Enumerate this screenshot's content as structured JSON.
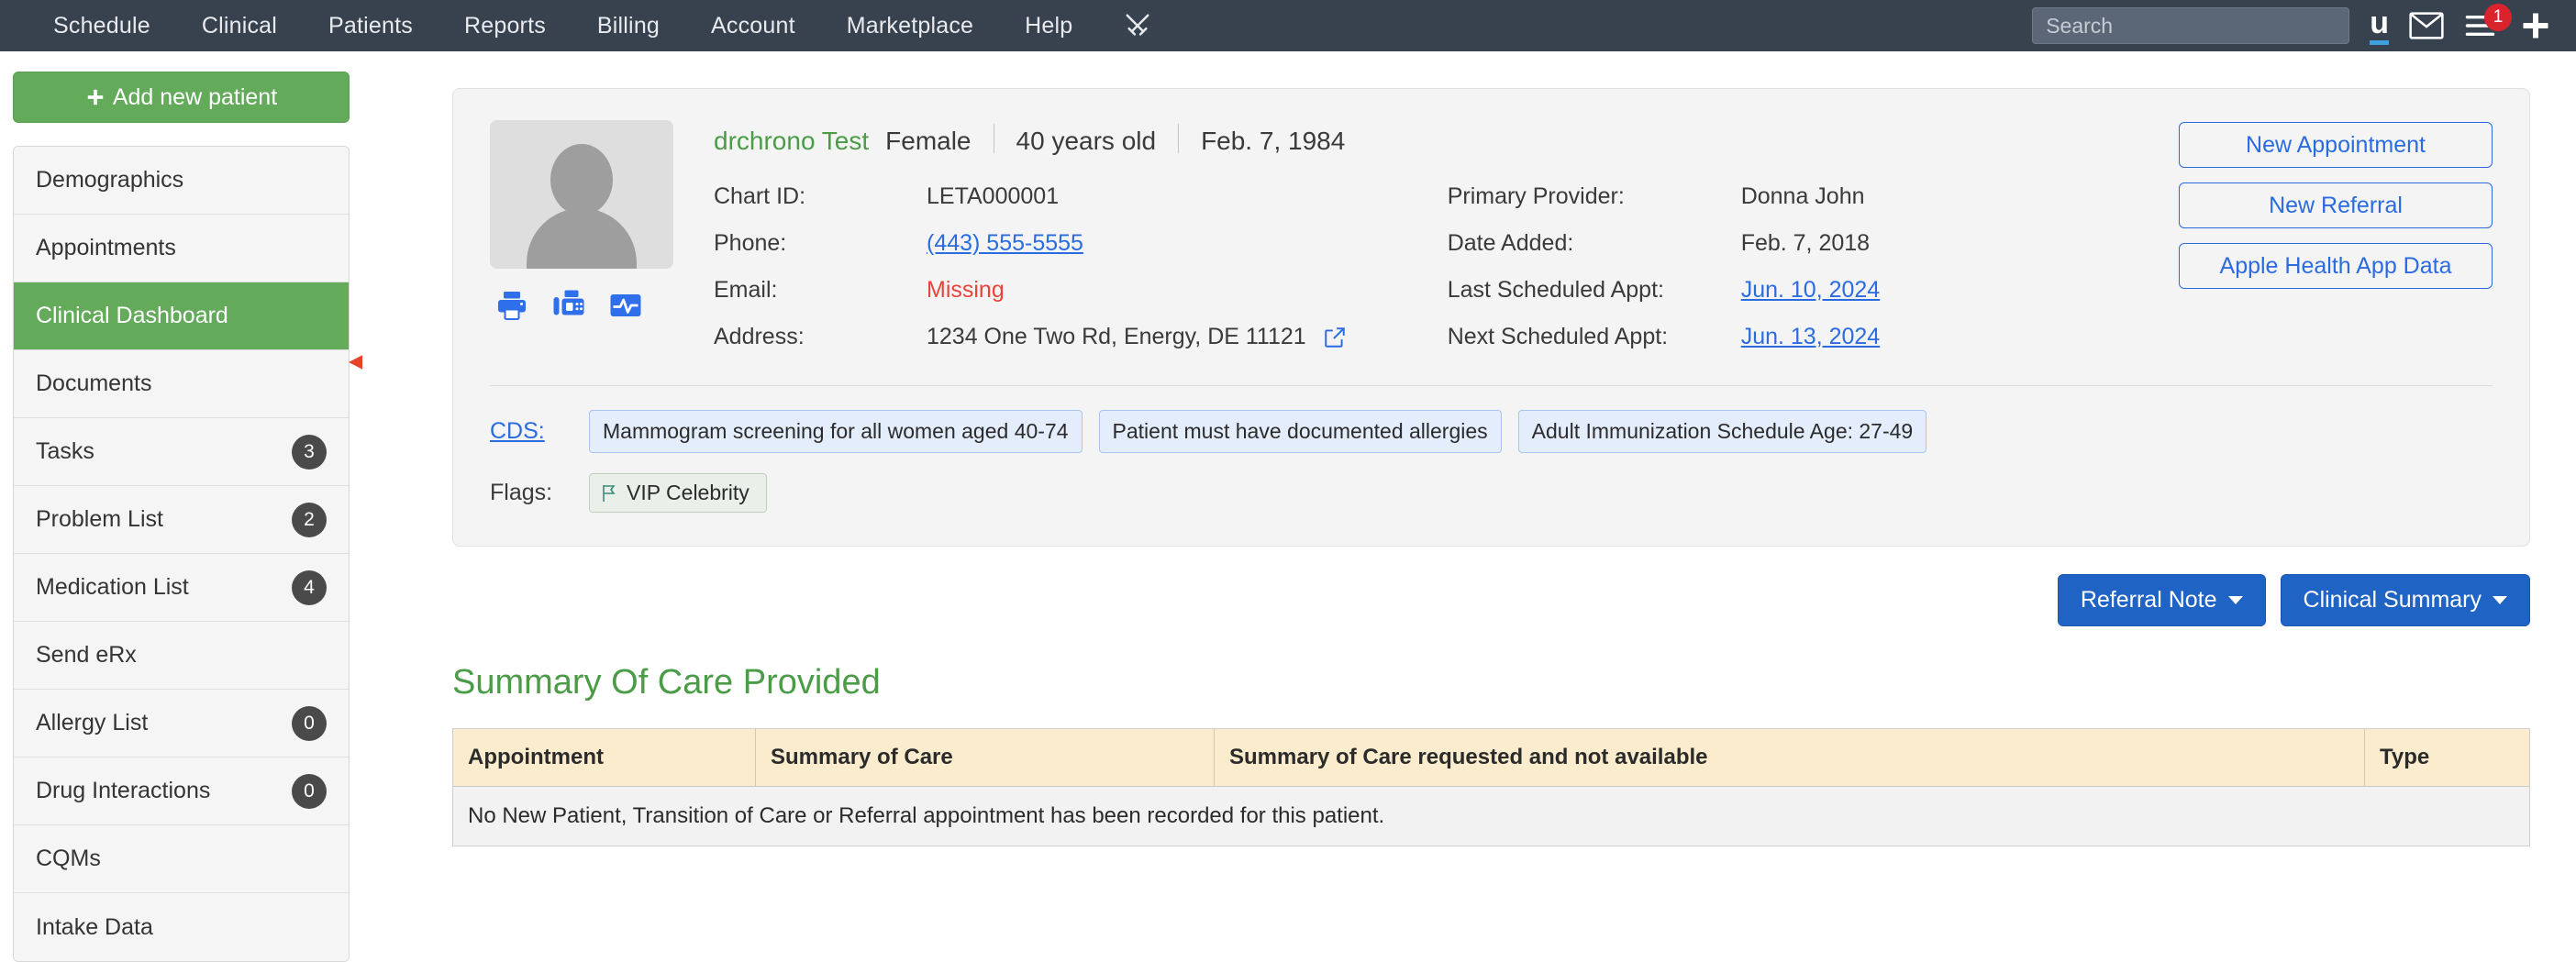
{
  "topnav": {
    "links": [
      "Schedule",
      "Clinical",
      "Patients",
      "Reports",
      "Billing",
      "Account",
      "Marketplace",
      "Help"
    ],
    "swords_icon": "crossed-swords-icon",
    "search_placeholder": "Search",
    "search_value": "",
    "brand_letter": "u",
    "mail_icon": "envelope-icon",
    "list_icon": "hamburger-list-icon",
    "notification_count": "1",
    "plus_icon": "plus-icon",
    "bar_color": "#38424f",
    "badge_color": "#d9232d"
  },
  "sidebar": {
    "add_patient_label": "Add new patient",
    "add_patient_color": "#63ab5b",
    "items": [
      {
        "label": "Demographics",
        "badge": "",
        "active": false
      },
      {
        "label": "Appointments",
        "badge": "",
        "active": false
      },
      {
        "label": "Clinical Dashboard",
        "badge": "",
        "active": true
      },
      {
        "label": "Documents",
        "badge": "",
        "active": false
      },
      {
        "label": "Tasks",
        "badge": "3",
        "active": false
      },
      {
        "label": "Problem List",
        "badge": "2",
        "active": false
      },
      {
        "label": "Medication List",
        "badge": "4",
        "active": false
      },
      {
        "label": "Send eRx",
        "badge": "",
        "active": false
      },
      {
        "label": "Allergy List",
        "badge": "0",
        "active": false
      },
      {
        "label": "Drug Interactions",
        "badge": "0",
        "active": false
      },
      {
        "label": "CQMs",
        "badge": "",
        "active": false
      },
      {
        "label": "Intake Data",
        "badge": "",
        "active": false
      }
    ]
  },
  "annotation": {
    "arrow_color": "#e8432a",
    "points_at": "Clinical Dashboard"
  },
  "patient": {
    "name": "drchrono Test",
    "name_color": "#4a9c47",
    "gender": "Female",
    "age": "40 years old",
    "dob": "Feb. 7, 1984",
    "avatar_icon": "person-avatar-icon",
    "quick_icons": [
      "print-icon",
      "fax-icon",
      "vitals-chart-icon"
    ],
    "left_fields": [
      {
        "label": "Chart ID:",
        "value": "LETA000001",
        "kind": "text"
      },
      {
        "label": "Phone:",
        "value": "(443) 555-5555",
        "kind": "link"
      },
      {
        "label": "Email:",
        "value": "Missing",
        "kind": "missing"
      },
      {
        "label": "Address:",
        "value": "1234 One Two Rd, Energy, DE 11121",
        "kind": "address"
      }
    ],
    "right_fields": [
      {
        "label": "Primary Provider:",
        "value": "Donna John",
        "kind": "text"
      },
      {
        "label": "Date Added:",
        "value": "Feb. 7, 2018",
        "kind": "text"
      },
      {
        "label": "Last Scheduled Appt:",
        "value": "Jun. 10, 2024",
        "kind": "link"
      },
      {
        "label": "Next Scheduled Appt:",
        "value": "Jun. 13, 2024",
        "kind": "link"
      }
    ],
    "actions": [
      "New Appointment",
      "New Referral",
      "Apple Health App Data"
    ],
    "action_color": "#2a6ce0",
    "cds_label": "CDS:",
    "cds_chips": [
      "Mammogram screening for all women aged 40-74",
      "Patient must have documented allergies",
      "Adult Immunization Schedule Age: 27-49"
    ],
    "flags_label": "Flags:",
    "flags": [
      {
        "icon": "flag-icon",
        "label": "VIP Celebrity"
      }
    ]
  },
  "doc_buttons": [
    {
      "label": "Referral Note",
      "has_caret": true
    },
    {
      "label": "Clinical Summary",
      "has_caret": true
    }
  ],
  "summary_of_care": {
    "title": "Summary Of Care Provided",
    "title_color": "#4a9c47",
    "columns": [
      "Appointment",
      "Summary of Care",
      "Summary of Care requested and not available",
      "Type"
    ],
    "header_bg": "#faeccc",
    "empty_message": "No New Patient, Transition of Care or Referral appointment has been recorded for this patient."
  }
}
